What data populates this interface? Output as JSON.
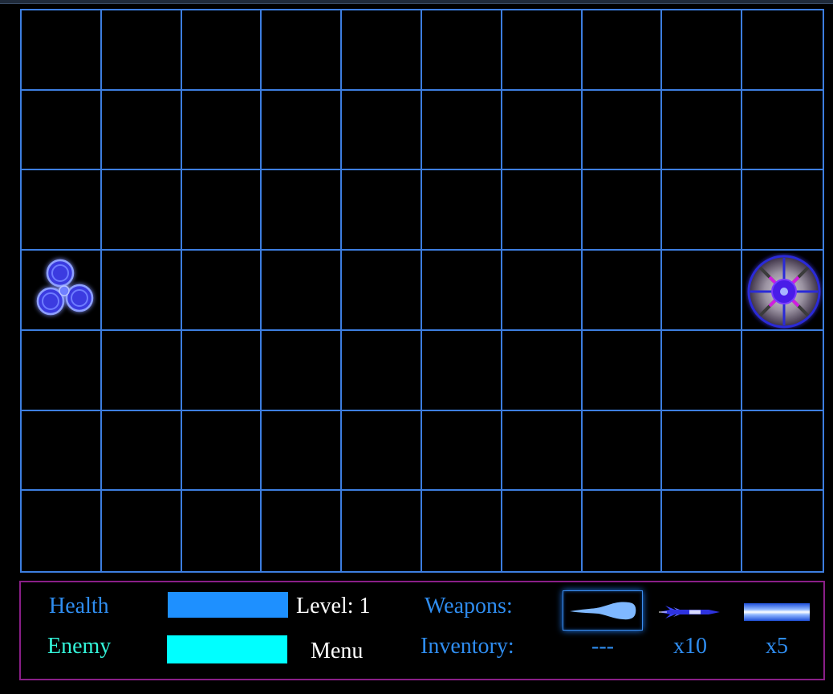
{
  "hud": {
    "health_label": "Health",
    "enemy_label": "Enemy",
    "health_fraction": 1.0,
    "enemy_fraction": 1.0,
    "level_label": "Level: 1",
    "menu_label": "Menu",
    "weapons_label": "Weapons:",
    "inventory_label": "Inventory:"
  },
  "weapons": [
    {
      "icon": "plasma-blast-icon",
      "count": "---",
      "selected": true
    },
    {
      "icon": "missile-icon",
      "count": "x10",
      "selected": false
    },
    {
      "icon": "laser-beam-icon",
      "count": "x5",
      "selected": false
    }
  ],
  "board": {
    "columns": 10,
    "rows": 7,
    "grid_color": "#3d7ee0",
    "player": {
      "icon": "tri-orb-ship-icon",
      "col": 0,
      "row": 3
    },
    "enemy": {
      "icon": "wheel-ship-icon",
      "col": 9,
      "row": 3
    }
  },
  "colors": {
    "background": "#000000",
    "grid": "#3d7ee0",
    "hud_border": "#8a1f88",
    "health": "#1e90ff",
    "enemy": "#00ffff",
    "text_blue": "#2f8df0",
    "text_cyan": "#33f3d9"
  }
}
